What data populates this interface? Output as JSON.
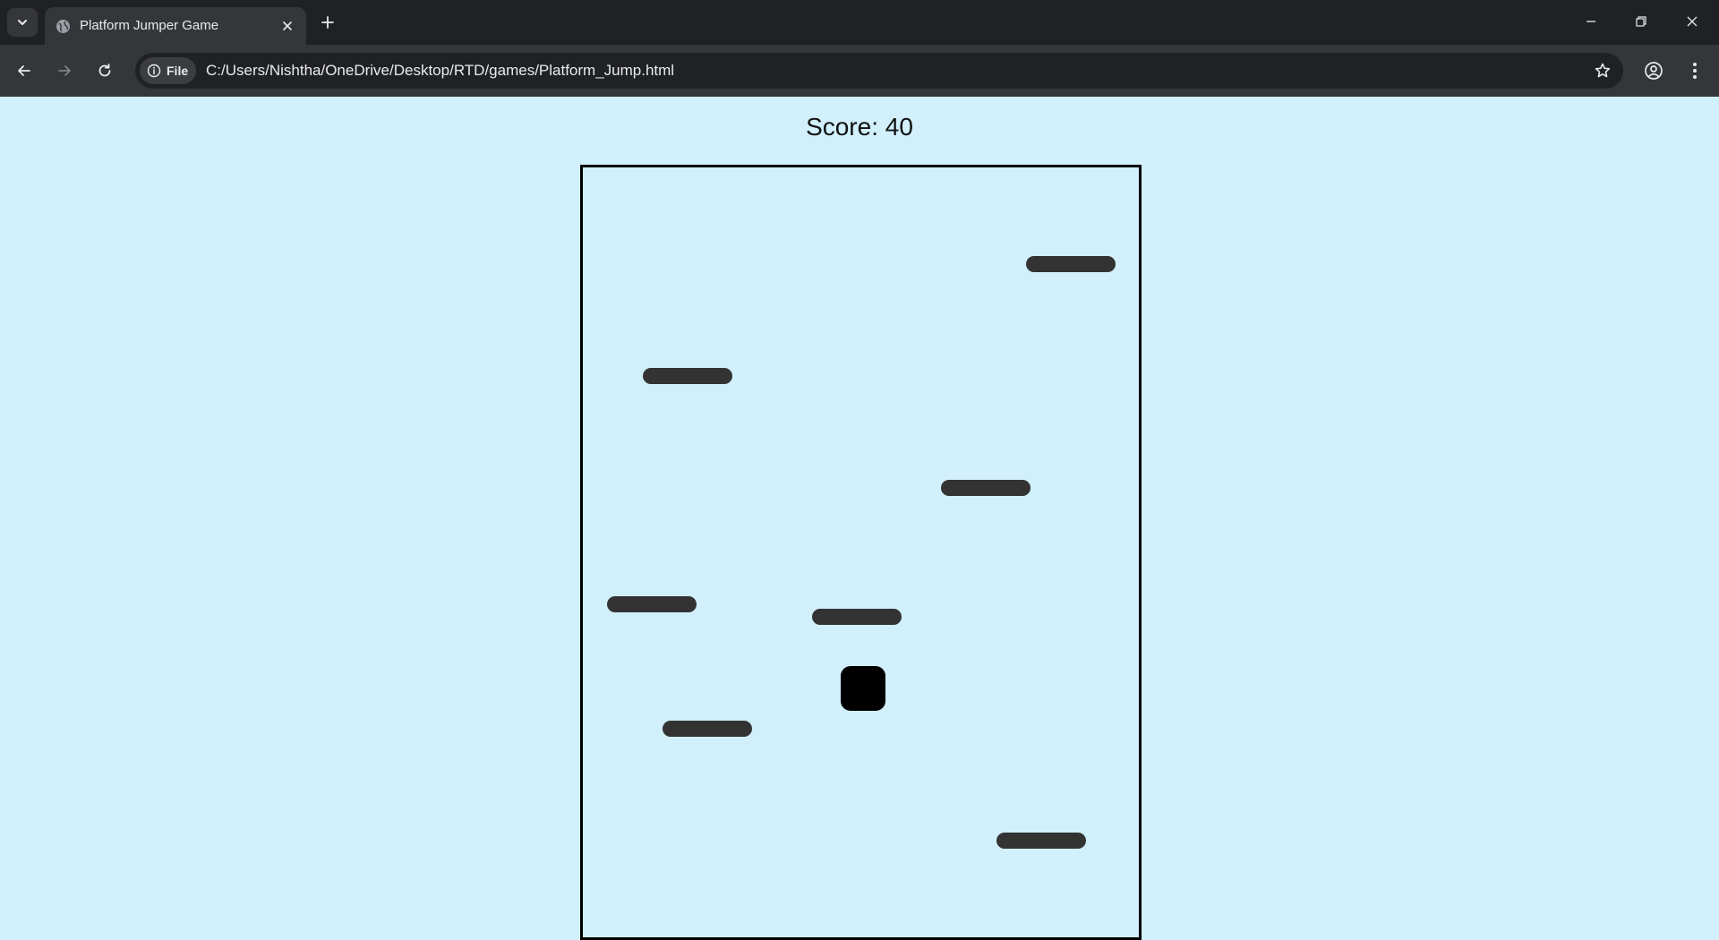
{
  "browser": {
    "tab": {
      "title": "Platform Jumper Game",
      "favicon_icon": "globe-icon",
      "close_icon": "close-icon"
    },
    "new_tab_icon": "plus-icon",
    "tab_search_icon": "chevron-down-icon",
    "window_controls": [
      "minimize-icon",
      "restore-icon",
      "close-icon"
    ],
    "nav": {
      "back_icon": "arrow-left-icon",
      "forward_icon": "arrow-right-icon",
      "reload_icon": "reload-icon"
    },
    "omnibox": {
      "site_chip_label": "File",
      "url": "C:/Users/Nishtha/OneDrive/Desktop/RTD/games/Platform_Jump.html",
      "bookmark_icon": "star-icon"
    },
    "profile_icon": "account-circle-icon",
    "menu_icon": "more-vertical-icon"
  },
  "game": {
    "score_text": "Score: 40",
    "colors": {
      "background": "#d1f0fc",
      "platform": "#333333",
      "player": "#000000",
      "border": "#000000"
    }
  }
}
